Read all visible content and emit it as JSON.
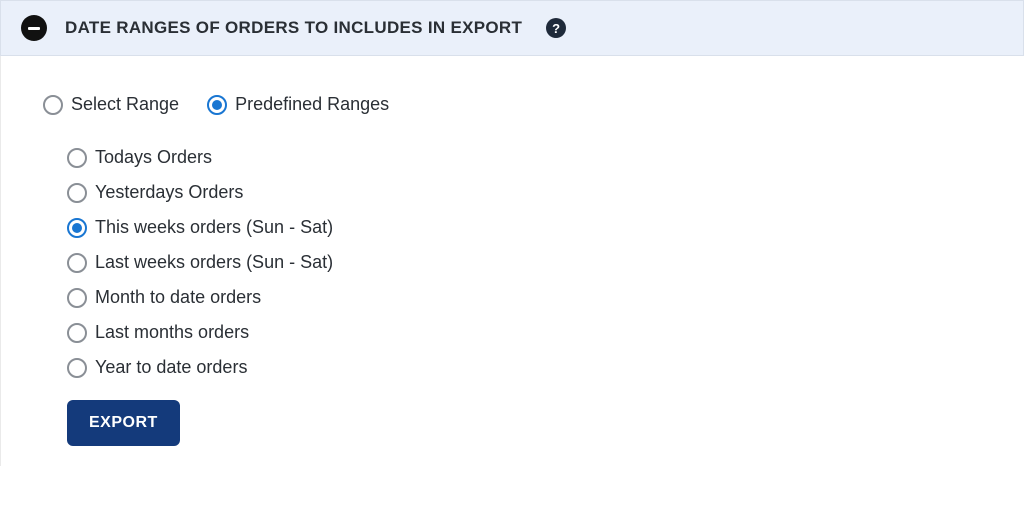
{
  "header": {
    "title": "DATE RANGES OF ORDERS TO INCLUDES IN EXPORT",
    "help_glyph": "?"
  },
  "mode": {
    "select_range_label": "Select Range",
    "predefined_label": "Predefined Ranges",
    "selected": "predefined"
  },
  "predefined_options": [
    {
      "label": "Todays Orders",
      "selected": false
    },
    {
      "label": "Yesterdays Orders",
      "selected": false
    },
    {
      "label": "This weeks orders (Sun - Sat)",
      "selected": true
    },
    {
      "label": "Last weeks orders (Sun - Sat)",
      "selected": false
    },
    {
      "label": "Month to date orders",
      "selected": false
    },
    {
      "label": "Last months orders",
      "selected": false
    },
    {
      "label": "Year to date orders",
      "selected": false
    }
  ],
  "actions": {
    "export_label": "EXPORT"
  }
}
